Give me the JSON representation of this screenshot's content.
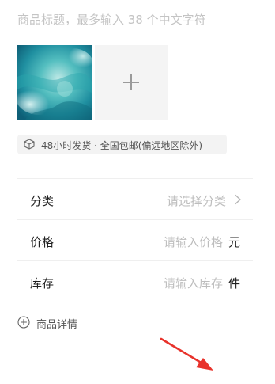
{
  "title_field": {
    "placeholder": "商品标题，最多输入 38 个中文字符"
  },
  "photos": {
    "thumbnail": "teal-abstract-cloud-image",
    "add_icon": "plus-icon"
  },
  "shipping": {
    "icon": "package-box-icon",
    "text": "48小时发货 · 全国包邮(偏远地区除外)"
  },
  "form": {
    "category": {
      "label": "分类",
      "placeholder": "请选择分类",
      "icon": "chevron-right-icon"
    },
    "price": {
      "label": "价格",
      "placeholder": "请输入价格",
      "unit": "元"
    },
    "stock": {
      "label": "库存",
      "placeholder": "请输入库存",
      "unit": "件"
    }
  },
  "details": {
    "icon": "circle-plus-icon",
    "label": "商品详情"
  },
  "annotation": {
    "icon": "red-arrow-icon",
    "color": "#e8322b"
  }
}
